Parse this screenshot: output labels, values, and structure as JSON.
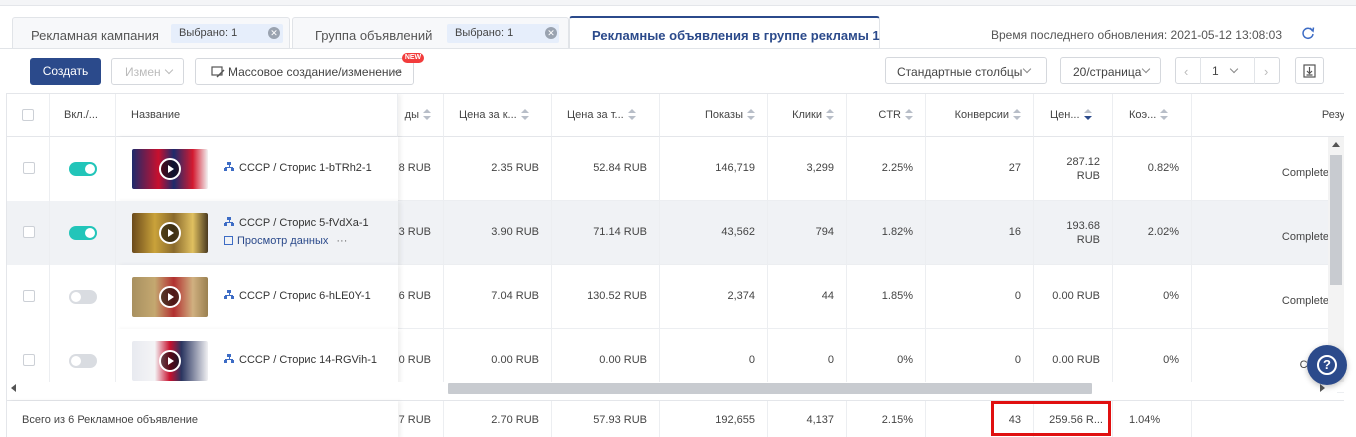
{
  "tabs": [
    {
      "label": "Рекламная кампания",
      "chip": "Выбрано: 1"
    },
    {
      "label": "Группа объявлений",
      "chip": "Выбрано: 1"
    },
    {
      "label": "Рекламные объявления в группе рекламы 1"
    }
  ],
  "update_text": "Время последнего обновления: 2021-05-12 13:08:03",
  "toolbar": {
    "create_label": "Создать",
    "edit_label": "Измен",
    "bulk_label": "Массовое создание/изменение",
    "new_badge": "NEW",
    "columns_select": "Стандартные столбцы",
    "page_size_select": "20/страница",
    "page_number": "1"
  },
  "columns": {
    "toggle": "Вкл./...",
    "name": "Название",
    "budget_fragment": "ды",
    "cpc": "Цена за к...",
    "cpm": "Цена за т...",
    "impressions": "Показы",
    "clicks": "Клики",
    "ctr": "CTR",
    "conversions": "Конверсии",
    "cost_per_conv": "Цен...",
    "conv_rate": "Коэ...",
    "result": "Резу"
  },
  "rows": [
    {
      "name": "СССР / Сторис 1-bTRh2-1",
      "enabled": true,
      "budget": "8 RUB",
      "cpc": "2.35 RUB",
      "cpm": "52.84 RUB",
      "impressions": "146,719",
      "clicks": "3,299",
      "ctr": "2.25%",
      "conversions": "27",
      "cost_per_conv_1": "287.12",
      "cost_per_conv_2": "RUB",
      "conv_rate": "0.82%",
      "result": "Complete"
    },
    {
      "name": "СССР / Сторис 5-fVdXa-1",
      "enabled": true,
      "sublink": "Просмотр данных",
      "more": "···",
      "budget": "3 RUB",
      "cpc": "3.90 RUB",
      "cpm": "71.14 RUB",
      "impressions": "43,562",
      "clicks": "794",
      "ctr": "1.82%",
      "conversions": "16",
      "cost_per_conv_1": "193.68",
      "cost_per_conv_2": "RUB",
      "conv_rate": "2.02%",
      "result": "Complete"
    },
    {
      "name": "СССР / Сторис 6-hLE0Y-1",
      "enabled": false,
      "budget": "6 RUB",
      "cpc": "7.04 RUB",
      "cpm": "130.52 RUB",
      "impressions": "2,374",
      "clicks": "44",
      "ctr": "1.85%",
      "conversions": "0",
      "cost_per_conv_1": "0.00 RUB",
      "conv_rate": "0%",
      "result": "Complete"
    },
    {
      "name": "СССР / Сторис 14-RGVih-1",
      "enabled": false,
      "budget": "0 RUB",
      "cpc": "0.00 RUB",
      "cpm": "0.00 RUB",
      "impressions": "0",
      "clicks": "0",
      "ctr": "0%",
      "conversions": "0",
      "cost_per_conv_1": "0.00 RUB",
      "conv_rate": "0%",
      "result": "Comp"
    }
  ],
  "footer": {
    "label": "Всего из 6 Рекламное объявление",
    "budget": "7 RUB",
    "cpc": "2.70 RUB",
    "cpm": "57.93 RUB",
    "impressions": "192,655",
    "clicks": "4,137",
    "ctr": "2.15%",
    "conversions": "43",
    "cost_per_conv": "259.56 R...",
    "conv_rate": "1.04%"
  },
  "help_label": "?",
  "colors": {
    "primary": "#2b4a8b",
    "toggle_on": "#22c5b9",
    "highlight": "#e01010"
  }
}
